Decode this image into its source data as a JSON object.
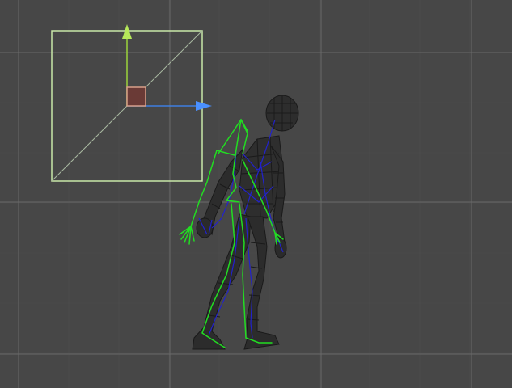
{
  "viewport": {
    "background": "#474747",
    "grid_color": "#5b5b5b",
    "grid_major_color": "#6a6a6a"
  },
  "gizmo": {
    "rect_color": "#c9e8a8",
    "x_axis_color": "#3f7fe0",
    "y_axis_color": "#9bd33b",
    "center_handle_color": "#d8a08a",
    "center_fill_color": "#6a3a36"
  },
  "character": {
    "mesh_wire_color": "#1a1a1a",
    "inner_wire_color": "#2222cc",
    "skeleton_color": "#22dd22"
  },
  "icons": {
    "x_axis_arrow": "arrow-right-icon",
    "y_axis_arrow": "arrow-up-icon",
    "center_handle": "square-handle-icon"
  }
}
